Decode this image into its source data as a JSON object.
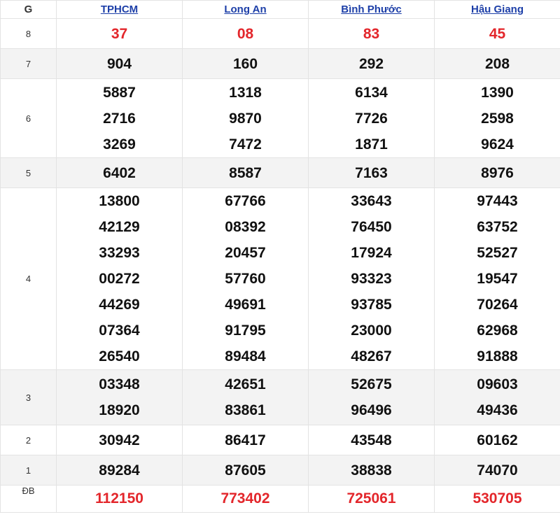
{
  "header": {
    "prize_col": "G",
    "provinces": [
      "TPHCM",
      "Long An",
      "Bình Phước",
      "Hậu Giang"
    ]
  },
  "rows": [
    {
      "label": "8",
      "red": true,
      "values": [
        [
          "37"
        ],
        [
          "08"
        ],
        [
          "83"
        ],
        [
          "45"
        ]
      ]
    },
    {
      "label": "7",
      "red": false,
      "values": [
        [
          "904"
        ],
        [
          "160"
        ],
        [
          "292"
        ],
        [
          "208"
        ]
      ]
    },
    {
      "label": "6",
      "red": false,
      "values": [
        [
          "5887",
          "2716",
          "3269"
        ],
        [
          "1318",
          "9870",
          "7472"
        ],
        [
          "6134",
          "7726",
          "1871"
        ],
        [
          "1390",
          "2598",
          "9624"
        ]
      ]
    },
    {
      "label": "5",
      "red": false,
      "values": [
        [
          "6402"
        ],
        [
          "8587"
        ],
        [
          "7163"
        ],
        [
          "8976"
        ]
      ]
    },
    {
      "label": "4",
      "red": false,
      "values": [
        [
          "13800",
          "42129",
          "33293",
          "00272",
          "44269",
          "07364",
          "26540"
        ],
        [
          "67766",
          "08392",
          "20457",
          "57760",
          "49691",
          "91795",
          "89484"
        ],
        [
          "33643",
          "76450",
          "17924",
          "93323",
          "93785",
          "23000",
          "48267"
        ],
        [
          "97443",
          "63752",
          "52527",
          "19547",
          "70264",
          "62968",
          "91888"
        ]
      ]
    },
    {
      "label": "3",
      "red": false,
      "values": [
        [
          "03348",
          "18920"
        ],
        [
          "42651",
          "83861"
        ],
        [
          "52675",
          "96496"
        ],
        [
          "09603",
          "49436"
        ]
      ]
    },
    {
      "label": "2",
      "red": false,
      "values": [
        [
          "30942"
        ],
        [
          "86417"
        ],
        [
          "43548"
        ],
        [
          "60162"
        ]
      ]
    },
    {
      "label": "1",
      "red": false,
      "values": [
        [
          "89284"
        ],
        [
          "87605"
        ],
        [
          "38838"
        ],
        [
          "74070"
        ]
      ]
    },
    {
      "label": "ĐB",
      "red": true,
      "values": [
        [
          "112150"
        ],
        [
          "773402"
        ],
        [
          "725061"
        ],
        [
          "530705"
        ]
      ]
    }
  ],
  "colors": {
    "red": "#e3262b",
    "link": "#1d3fa8",
    "alt_row": "#f3f3f3"
  }
}
